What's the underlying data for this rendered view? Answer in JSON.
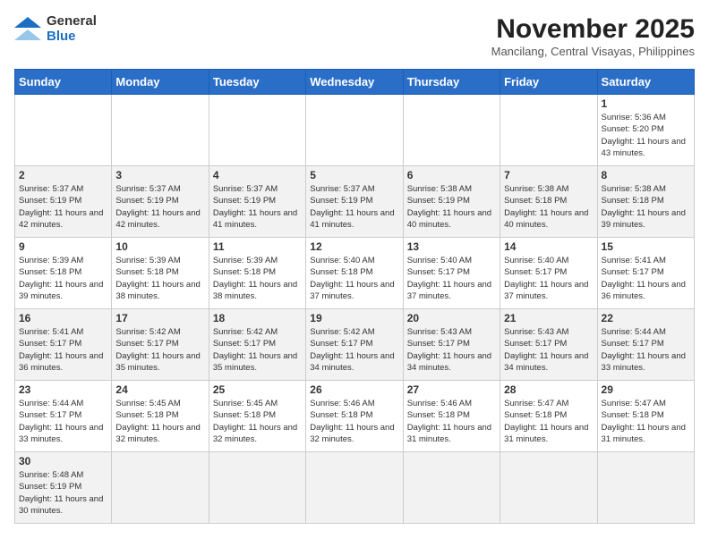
{
  "header": {
    "logo_general": "General",
    "logo_blue": "Blue",
    "month_title": "November 2025",
    "location": "Mancilang, Central Visayas, Philippines"
  },
  "weekdays": [
    "Sunday",
    "Monday",
    "Tuesday",
    "Wednesday",
    "Thursday",
    "Friday",
    "Saturday"
  ],
  "weeks": [
    [
      {
        "day": "",
        "info": ""
      },
      {
        "day": "",
        "info": ""
      },
      {
        "day": "",
        "info": ""
      },
      {
        "day": "",
        "info": ""
      },
      {
        "day": "",
        "info": ""
      },
      {
        "day": "",
        "info": ""
      },
      {
        "day": "1",
        "info": "Sunrise: 5:36 AM\nSunset: 5:20 PM\nDaylight: 11 hours\nand 43 minutes."
      }
    ],
    [
      {
        "day": "2",
        "info": "Sunrise: 5:37 AM\nSunset: 5:19 PM\nDaylight: 11 hours\nand 42 minutes."
      },
      {
        "day": "3",
        "info": "Sunrise: 5:37 AM\nSunset: 5:19 PM\nDaylight: 11 hours\nand 42 minutes."
      },
      {
        "day": "4",
        "info": "Sunrise: 5:37 AM\nSunset: 5:19 PM\nDaylight: 11 hours\nand 41 minutes."
      },
      {
        "day": "5",
        "info": "Sunrise: 5:37 AM\nSunset: 5:19 PM\nDaylight: 11 hours\nand 41 minutes."
      },
      {
        "day": "6",
        "info": "Sunrise: 5:38 AM\nSunset: 5:19 PM\nDaylight: 11 hours\nand 40 minutes."
      },
      {
        "day": "7",
        "info": "Sunrise: 5:38 AM\nSunset: 5:18 PM\nDaylight: 11 hours\nand 40 minutes."
      },
      {
        "day": "8",
        "info": "Sunrise: 5:38 AM\nSunset: 5:18 PM\nDaylight: 11 hours\nand 39 minutes."
      }
    ],
    [
      {
        "day": "9",
        "info": "Sunrise: 5:39 AM\nSunset: 5:18 PM\nDaylight: 11 hours\nand 39 minutes."
      },
      {
        "day": "10",
        "info": "Sunrise: 5:39 AM\nSunset: 5:18 PM\nDaylight: 11 hours\nand 38 minutes."
      },
      {
        "day": "11",
        "info": "Sunrise: 5:39 AM\nSunset: 5:18 PM\nDaylight: 11 hours\nand 38 minutes."
      },
      {
        "day": "12",
        "info": "Sunrise: 5:40 AM\nSunset: 5:18 PM\nDaylight: 11 hours\nand 37 minutes."
      },
      {
        "day": "13",
        "info": "Sunrise: 5:40 AM\nSunset: 5:17 PM\nDaylight: 11 hours\nand 37 minutes."
      },
      {
        "day": "14",
        "info": "Sunrise: 5:40 AM\nSunset: 5:17 PM\nDaylight: 11 hours\nand 37 minutes."
      },
      {
        "day": "15",
        "info": "Sunrise: 5:41 AM\nSunset: 5:17 PM\nDaylight: 11 hours\nand 36 minutes."
      }
    ],
    [
      {
        "day": "16",
        "info": "Sunrise: 5:41 AM\nSunset: 5:17 PM\nDaylight: 11 hours\nand 36 minutes."
      },
      {
        "day": "17",
        "info": "Sunrise: 5:42 AM\nSunset: 5:17 PM\nDaylight: 11 hours\nand 35 minutes."
      },
      {
        "day": "18",
        "info": "Sunrise: 5:42 AM\nSunset: 5:17 PM\nDaylight: 11 hours\nand 35 minutes."
      },
      {
        "day": "19",
        "info": "Sunrise: 5:42 AM\nSunset: 5:17 PM\nDaylight: 11 hours\nand 34 minutes."
      },
      {
        "day": "20",
        "info": "Sunrise: 5:43 AM\nSunset: 5:17 PM\nDaylight: 11 hours\nand 34 minutes."
      },
      {
        "day": "21",
        "info": "Sunrise: 5:43 AM\nSunset: 5:17 PM\nDaylight: 11 hours\nand 34 minutes."
      },
      {
        "day": "22",
        "info": "Sunrise: 5:44 AM\nSunset: 5:17 PM\nDaylight: 11 hours\nand 33 minutes."
      }
    ],
    [
      {
        "day": "23",
        "info": "Sunrise: 5:44 AM\nSunset: 5:17 PM\nDaylight: 11 hours\nand 33 minutes."
      },
      {
        "day": "24",
        "info": "Sunrise: 5:45 AM\nSunset: 5:18 PM\nDaylight: 11 hours\nand 32 minutes."
      },
      {
        "day": "25",
        "info": "Sunrise: 5:45 AM\nSunset: 5:18 PM\nDaylight: 11 hours\nand 32 minutes."
      },
      {
        "day": "26",
        "info": "Sunrise: 5:46 AM\nSunset: 5:18 PM\nDaylight: 11 hours\nand 32 minutes."
      },
      {
        "day": "27",
        "info": "Sunrise: 5:46 AM\nSunset: 5:18 PM\nDaylight: 11 hours\nand 31 minutes."
      },
      {
        "day": "28",
        "info": "Sunrise: 5:47 AM\nSunset: 5:18 PM\nDaylight: 11 hours\nand 31 minutes."
      },
      {
        "day": "29",
        "info": "Sunrise: 5:47 AM\nSunset: 5:18 PM\nDaylight: 11 hours\nand 31 minutes."
      }
    ],
    [
      {
        "day": "30",
        "info": "Sunrise: 5:48 AM\nSunset: 5:19 PM\nDaylight: 11 hours\nand 30 minutes."
      },
      {
        "day": "",
        "info": ""
      },
      {
        "day": "",
        "info": ""
      },
      {
        "day": "",
        "info": ""
      },
      {
        "day": "",
        "info": ""
      },
      {
        "day": "",
        "info": ""
      },
      {
        "day": "",
        "info": ""
      }
    ]
  ]
}
